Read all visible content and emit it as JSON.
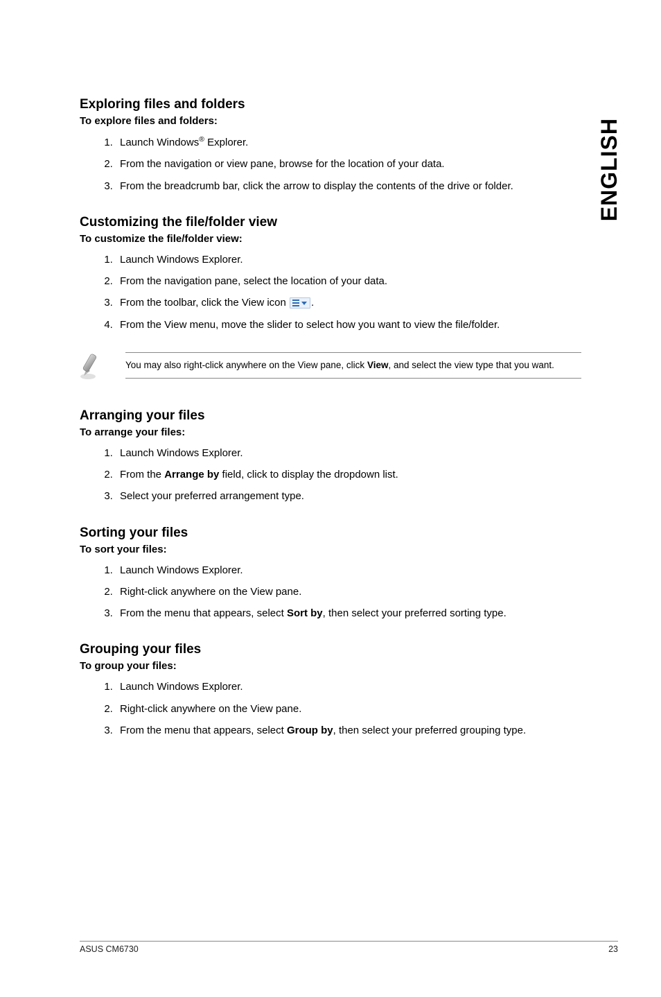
{
  "side_tab": "ENGLISH",
  "sections": [
    {
      "heading": "Exploring files and folders",
      "subheading": "To explore files and folders:",
      "items": [
        {
          "pre": "Launch Windows",
          "sup": "®",
          "post": " Explorer."
        },
        {
          "text": "From the navigation or view pane, browse for the location of your data."
        },
        {
          "text": "From the breadcrumb bar, click the arrow to display the contents of the drive or folder."
        }
      ]
    },
    {
      "heading": "Customizing the file/folder view",
      "subheading": "To customize the file/folder view:",
      "items": [
        {
          "text": "Launch Windows Explorer."
        },
        {
          "text": "From the navigation pane, select the location of your data."
        },
        {
          "pre": "From the toolbar, click the View icon ",
          "icon": true,
          "post": "."
        },
        {
          "text": "From the View menu, move the slider to select how you want to view the file/folder."
        }
      ],
      "note": {
        "pre": "You may also right-click anywhere on the View pane, click ",
        "bold": "View",
        "post": ", and select the view type that you want."
      }
    },
    {
      "heading": "Arranging your files",
      "subheading": "To arrange your files:",
      "items": [
        {
          "text": "Launch Windows Explorer."
        },
        {
          "pre": "From the ",
          "bold": "Arrange by",
          "post": " field, click to display the dropdown list."
        },
        {
          "text": "Select your preferred arrangement type."
        }
      ]
    },
    {
      "heading": "Sorting your files",
      "subheading": "To sort your files:",
      "items": [
        {
          "text": "Launch Windows Explorer."
        },
        {
          "text": "Right-click anywhere on the View pane."
        },
        {
          "pre": "From the menu that appears, select ",
          "bold": "Sort by",
          "post": ", then select your preferred sorting type."
        }
      ]
    },
    {
      "heading": "Grouping your files",
      "subheading": "To group your files:",
      "items": [
        {
          "text": "Launch Windows Explorer."
        },
        {
          "text": "Right-click anywhere on the View pane."
        },
        {
          "pre": "From the menu that appears, select ",
          "bold": "Group by",
          "post": ", then select your preferred grouping type."
        }
      ]
    }
  ],
  "footer": {
    "left": "ASUS CM6730",
    "right": "23"
  }
}
